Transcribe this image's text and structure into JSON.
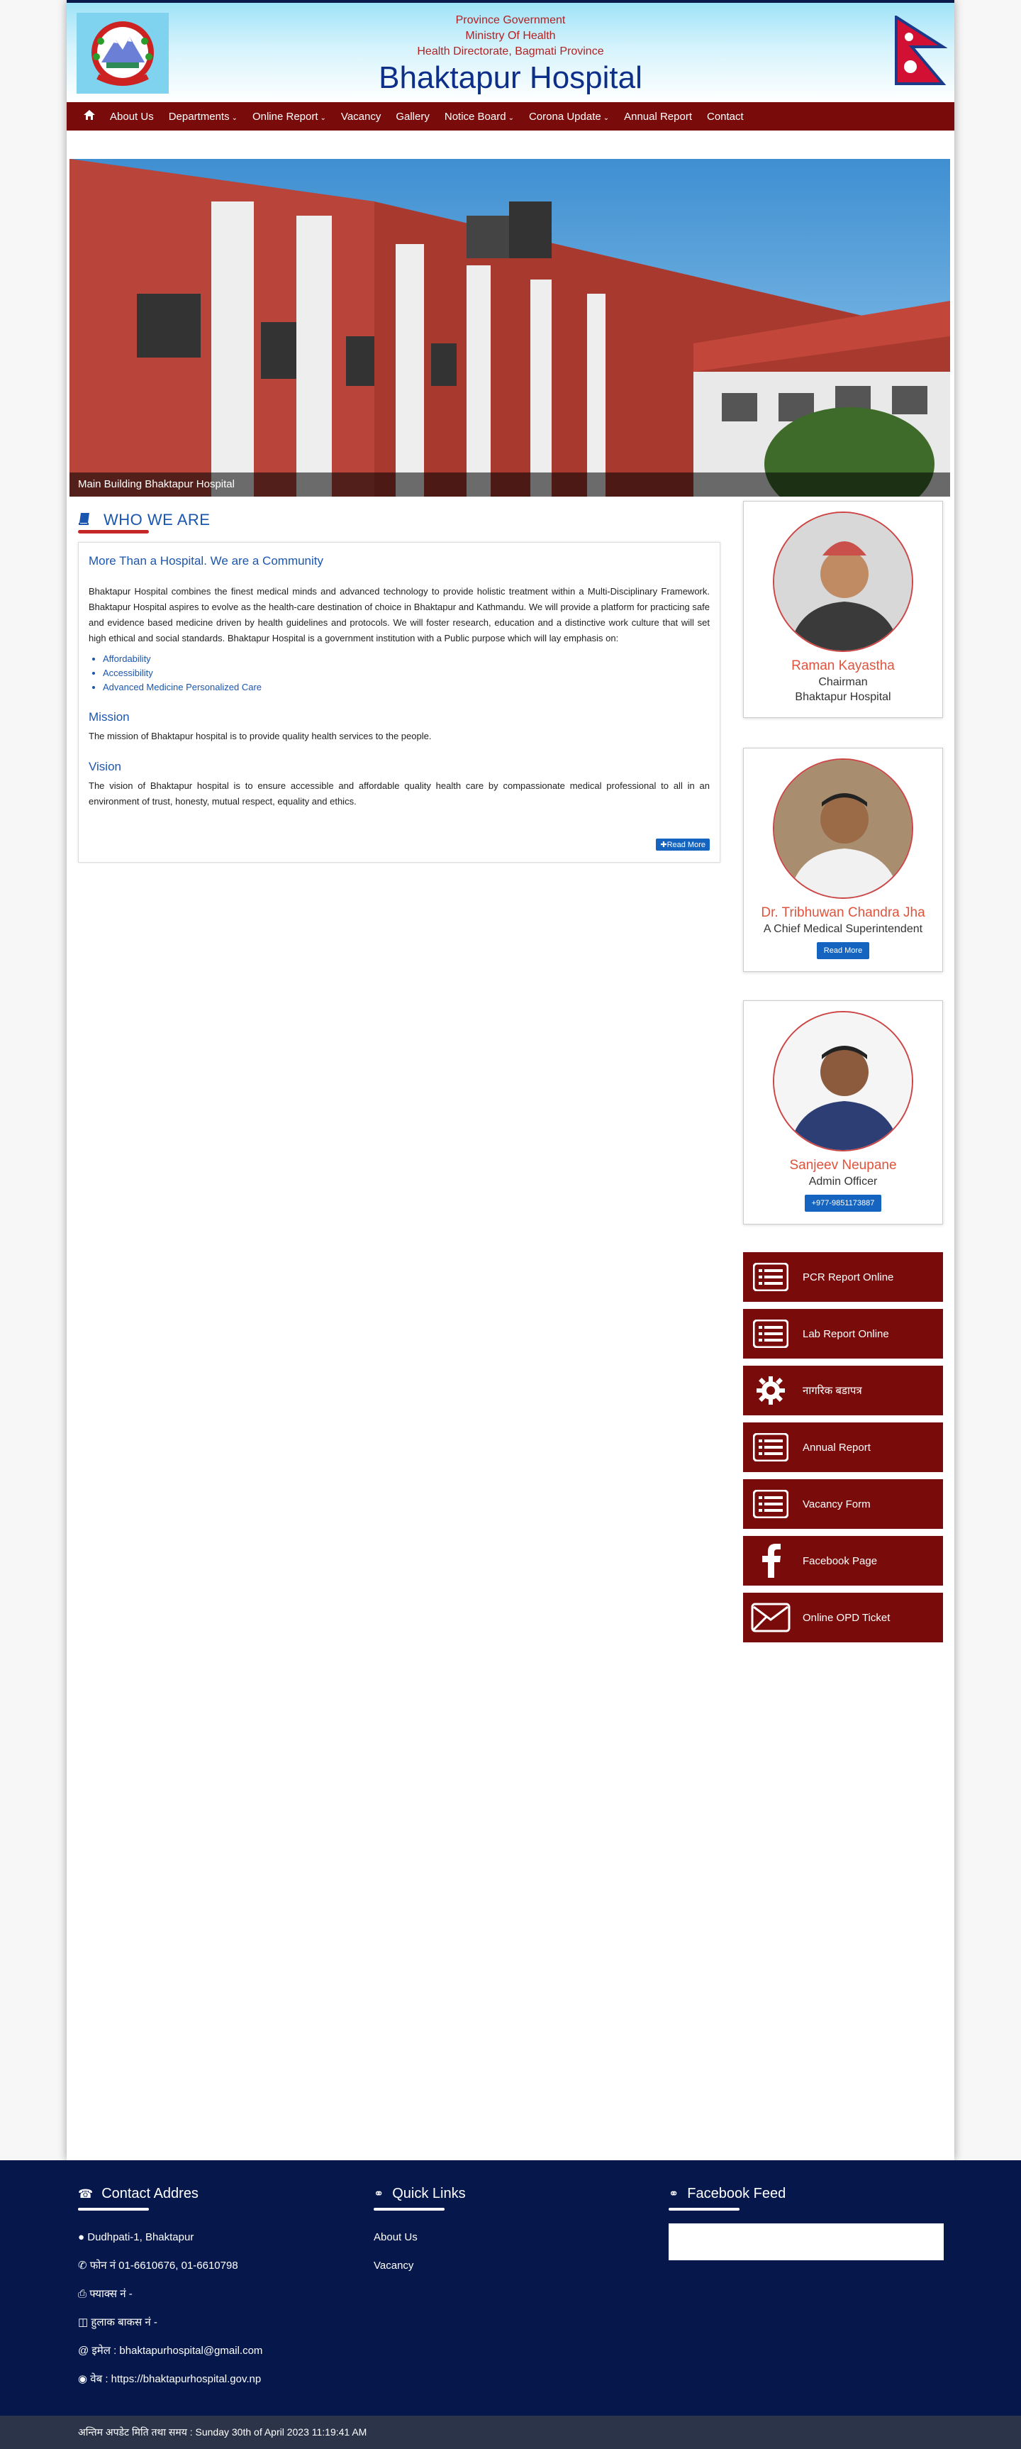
{
  "header": {
    "line1": "Province Government",
    "line2": "Ministry Of Health",
    "line3": "Health Directorate, Bagmati Province",
    "title": "Bhaktapur Hospital"
  },
  "nav": {
    "home_icon": "home-icon",
    "items": [
      {
        "label": "About Us",
        "dropdown": false
      },
      {
        "label": "Departments",
        "dropdown": true
      },
      {
        "label": "Online Report",
        "dropdown": true
      },
      {
        "label": "Vacancy",
        "dropdown": false
      },
      {
        "label": "Gallery",
        "dropdown": false
      },
      {
        "label": "Notice Board",
        "dropdown": true
      },
      {
        "label": "Corona Update",
        "dropdown": true
      },
      {
        "label": "Annual Report",
        "dropdown": false
      },
      {
        "label": "Contact",
        "dropdown": false
      }
    ]
  },
  "banner": {
    "caption": "Main Building Bhaktapur Hospital"
  },
  "who_we_are": {
    "heading": "WHO WE ARE",
    "subtitle": "More Than a Hospital. We are a Community",
    "body": "Bhaktapur Hospital combines the finest medical minds and advanced technology to provide holistic treatment within a Multi-Disciplinary Framework. Bhaktapur Hospital aspires to evolve as the health-care destination of choice in Bhaktapur and Kathmandu. We will provide a platform for practicing safe and evidence based medicine driven by health guidelines and protocols. We will foster research, education and a distinctive work culture that will set high ethical and social standards. Bhaktapur Hospital is a government institution with a Public purpose which will lay emphasis on:",
    "points": [
      "Affordability",
      "Accessibility",
      "Advanced Medicine Personalized Care"
    ],
    "mission_title": "Mission",
    "mission_text": "The mission of Bhaktapur hospital is to provide quality health services to the people.",
    "vision_title": "Vision",
    "vision_text": "The vision of Bhaktapur hospital is to ensure accessible and affordable quality health care by compassionate medical professional to all in an environment of trust, honesty, mutual respect, equality and ethics.",
    "read_more": "Read More"
  },
  "people": [
    {
      "name": "Raman Kayastha",
      "role1": "Chairman",
      "role2": "Bhaktapur Hospital",
      "button": ""
    },
    {
      "name": "Dr. Tribhuwan Chandra Jha",
      "role1": "A Chief Medical Superintendent",
      "role2": "",
      "button": "Read More"
    },
    {
      "name": "Sanjeev Neupane",
      "role1": "Admin Officer",
      "role2": "",
      "button": "+977-9851173887"
    }
  ],
  "quick_buttons": [
    {
      "label": "PCR Report Online",
      "icon": "list-icon"
    },
    {
      "label": "Lab Report Online",
      "icon": "list-icon"
    },
    {
      "label": "नागरिक बडापत्र",
      "icon": "gear-icon"
    },
    {
      "label": "Annual Report",
      "icon": "list-icon"
    },
    {
      "label": "Vacancy Form",
      "icon": "list-icon"
    },
    {
      "label": "Facebook Page",
      "icon": "facebook-icon"
    },
    {
      "label": "Online OPD Ticket",
      "icon": "envelope-icon"
    }
  ],
  "footer": {
    "contact_title": "Contact Addres",
    "contact_lines": [
      "Dudhpati-1, Bhaktapur",
      "फोन नं 01-6610676, 01-6610798",
      "फ्याक्स नं -",
      "हुलाक बाकस नं -",
      "इमेल : bhaktapurhospital@gmail.com",
      "वेब : https://bhaktapurhospital.gov.np"
    ],
    "links_title": "Quick Links",
    "links": [
      "About Us",
      "Vacancy"
    ],
    "facebook_title": "Facebook Feed"
  },
  "bottom_bar": "अन्तिम अपडेट मिति तथा समय : Sunday 30th of April 2023 11:19:41 AM"
}
